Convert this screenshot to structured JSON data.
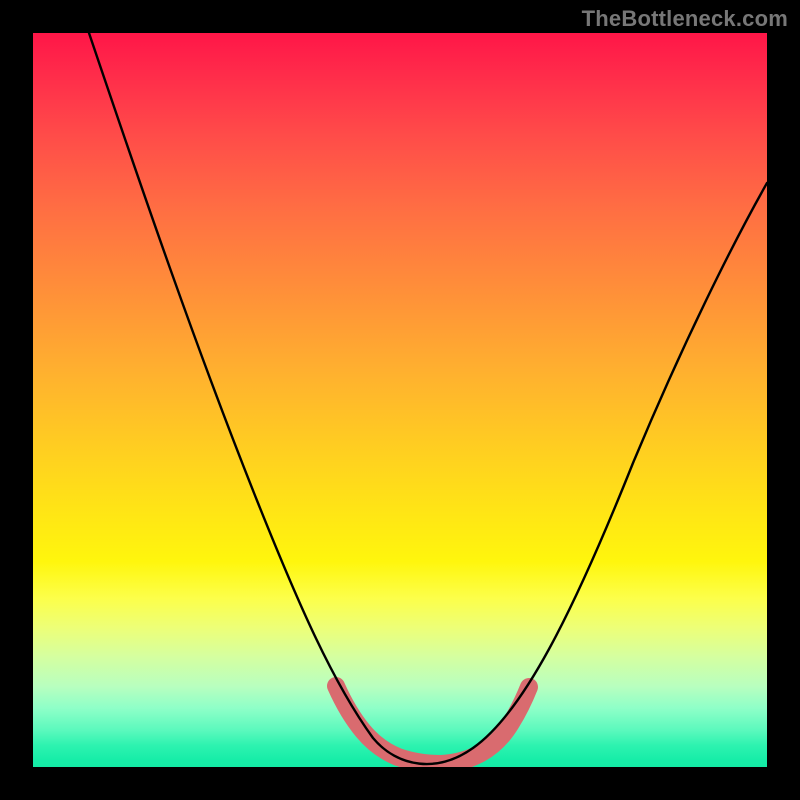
{
  "watermark": "TheBottleneck.com",
  "chart_data": {
    "type": "line",
    "title": "",
    "xlabel": "",
    "ylabel": "",
    "xlim": [
      0,
      100
    ],
    "ylim": [
      0,
      100
    ],
    "series": [
      {
        "name": "bottleneck-curve",
        "x": [
          0,
          6,
          12,
          18,
          24,
          30,
          34,
          38,
          42,
          46,
          50,
          54,
          58,
          62,
          66,
          70,
          76,
          82,
          88,
          94,
          100
        ],
        "values": [
          100,
          83,
          68,
          54,
          42,
          31,
          24,
          17,
          11,
          6,
          2,
          0,
          0,
          2,
          6,
          12,
          20,
          30,
          41,
          53,
          66
        ]
      },
      {
        "name": "sweet-spot-band",
        "x": [
          42,
          44,
          46,
          48,
          50,
          52,
          54,
          56,
          58,
          60,
          62,
          64,
          66
        ],
        "values": [
          10,
          7,
          5,
          3,
          2,
          1,
          0,
          0,
          1,
          2,
          3,
          5,
          8
        ]
      }
    ],
    "colors": {
      "curve": "#000000",
      "band": "#d96b6f",
      "gradient_top": "#ff1648",
      "gradient_bottom": "#14eaa5"
    }
  }
}
